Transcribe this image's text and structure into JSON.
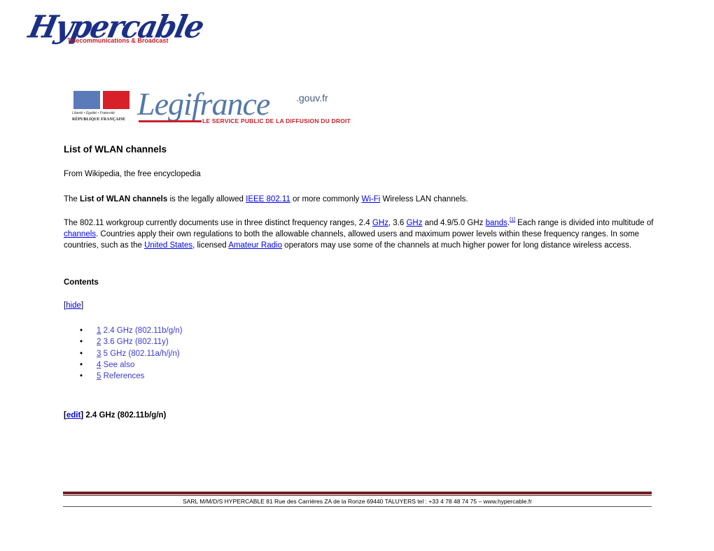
{
  "header": {
    "company_logo": {
      "name": "Hypercable",
      "tagline": "Telecommunications & Broadcast",
      "colors": {
        "primary": "#1b2f86",
        "accent": "#c8202a"
      }
    },
    "banner": {
      "motto": "Liberté • Égalité • Fraternité",
      "republic": "RÉPUBLIQUE FRANÇAISE",
      "name": "Legifrance",
      "domain": ".gouv.fr",
      "tagline": "LE SERVICE PUBLIC DE LA DIFFUSION DU DROIT"
    }
  },
  "article": {
    "title": "List of WLAN channels",
    "subtitle": "From Wikipedia, the free encyclopedia",
    "intro": {
      "t1": "The ",
      "bold": "List of WLAN channels",
      "t2": " is the legally allowed ",
      "link1": "IEEE 802.11",
      "t3": " or more commonly ",
      "link2": "Wi-Fi",
      "t4": " Wireless LAN channels."
    },
    "paragraph": {
      "t1": "The 802.11 workgroup currently documents use in three distinct frequency ranges, 2.4 ",
      "link_ghz1": "GHz",
      "t2": ", 3.6 ",
      "link_ghz2": "GHz",
      "t3": " and 4.9/5.0 GHz ",
      "link_bands": "bands",
      "t4": ".",
      "ref": "[1]",
      "t5": " Each range is divided into multitude of ",
      "link_channels": "channels",
      "t6": ". Countries apply their own regulations to both the allowable channels, allowed users and maximum power levels within these frequency ranges. In some countries, such as the ",
      "link_us": "United States",
      "t7": ", licensed ",
      "link_ham": "Amateur Radio",
      "t8": " operators may use some of the channels at much higher power for long distance wireless access."
    },
    "contents": {
      "heading": "Contents",
      "hide_open": "[",
      "hide_label": "hide",
      "hide_close": "]",
      "items": [
        {
          "num": "1",
          "label": " 2.4 GHz (802.11b/g/n)"
        },
        {
          "num": "2",
          "label": " 3.6 GHz (802.11y)"
        },
        {
          "num": "3",
          "label": " 5 GHz (802.11a/h/j/n)"
        },
        {
          "num": "4",
          "label": " See also"
        },
        {
          "num": "5",
          "label": " References"
        }
      ]
    },
    "section": {
      "open": "[",
      "edit_label": "edit",
      "close": "]",
      "title": " 2.4 GHz (802.11b/g/n)"
    }
  },
  "footer": {
    "text": "SARL M/M/D/S HYPERCABLE   81 Rue des Carrières ZA de la Ronze 69440 TALUYERS  tel : +33 4 78 48 74 75 – www.hypercable.fr",
    "bar_color": "#6b1f22"
  },
  "colors": {
    "link": "#0000ee",
    "text": "#000000"
  }
}
